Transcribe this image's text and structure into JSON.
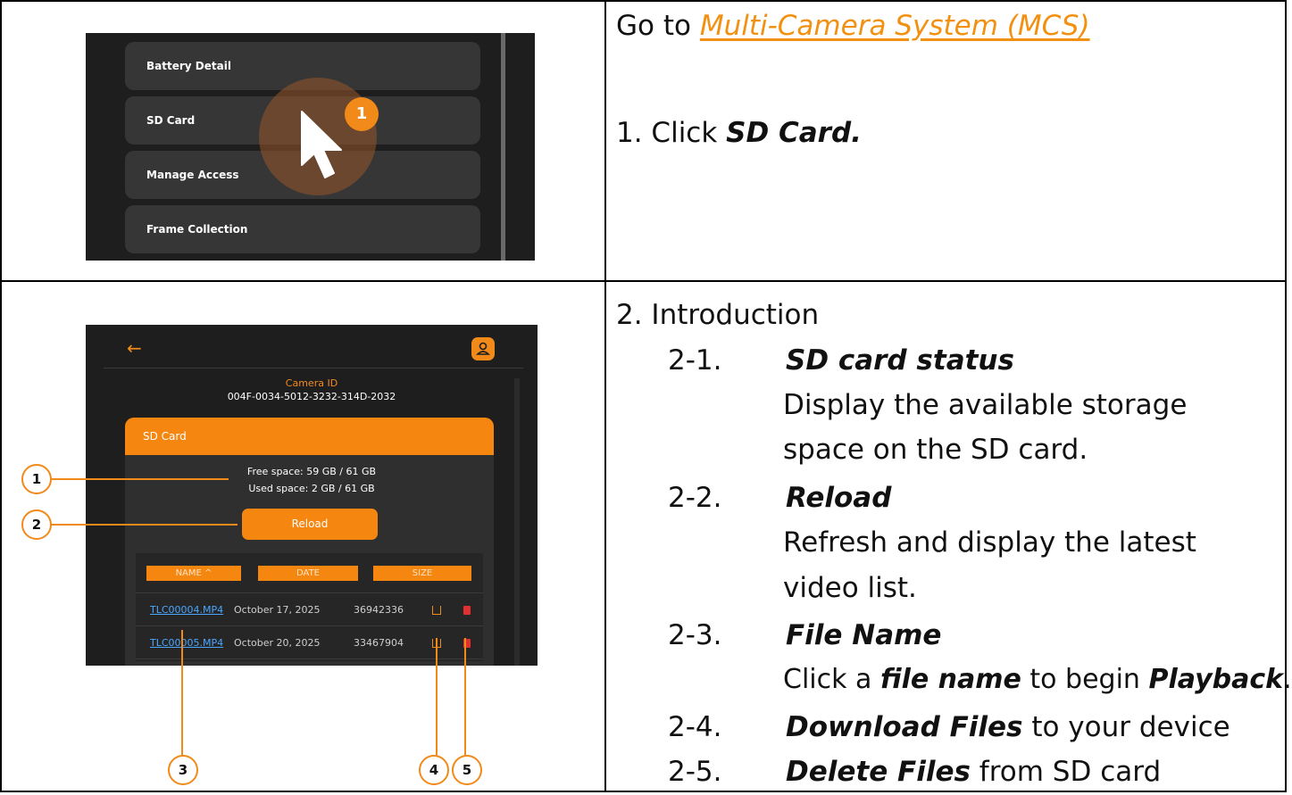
{
  "top_row": {
    "go_to_prefix": "Go to ",
    "go_to_link": "Multi-Camera System (MCS)",
    "step1_prefix": "1.  Click ",
    "step1_bold": "SD Card."
  },
  "screenshot1": {
    "menu_items": [
      "Battery Detail",
      "SD Card",
      "Manage Access",
      "Frame Collection"
    ],
    "badge": "1"
  },
  "screenshot2": {
    "camera_label": "Camera ID",
    "camera_id": "004F-0034-5012-3232-314D-2032",
    "card_title": "SD Card",
    "free_space": "Free space: 59 GB / 61 GB",
    "used_space": "Used space: 2 GB / 61 GB",
    "reload_label": "Reload",
    "columns": [
      "NAME ^",
      "DATE",
      "SIZE"
    ],
    "rows": [
      {
        "name": "TLC00004.MP4",
        "date": "October 17, 2025",
        "size": "36942336"
      },
      {
        "name": "TLC00005.MP4",
        "date": "October 20, 2025",
        "size": "33467904"
      }
    ],
    "callouts": [
      "1",
      "2",
      "3",
      "4",
      "5"
    ],
    "colors": {
      "accent": "#f5860f",
      "link": "#4aa6ff",
      "delete": "#e03030"
    }
  },
  "intro": {
    "title": "2.  Introduction",
    "items": [
      {
        "num": "2-1.",
        "title": "SD card status",
        "desc1": "Display the available storage",
        "desc2": "space on the SD card."
      },
      {
        "num": "2-2.",
        "title": "Reload",
        "desc1": "Refresh and display the latest",
        "desc2": "video list."
      },
      {
        "num": "2-3.",
        "title": "File Name",
        "desc_a": "Click a ",
        "desc_b": "file name",
        "desc_c": " to begin ",
        "desc_d": "Playback",
        "desc_e": "."
      },
      {
        "num": "2-4.",
        "title": "Download Files",
        "desc": " to your device"
      },
      {
        "num": "2-5.",
        "title": "Delete Files",
        "desc": " from SD card"
      }
    ]
  }
}
